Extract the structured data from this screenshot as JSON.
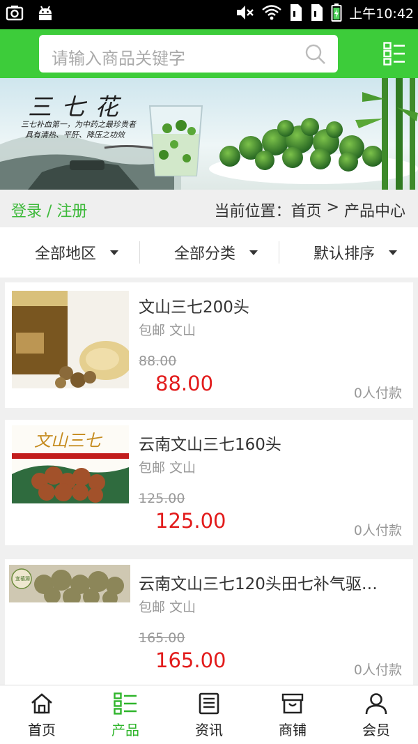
{
  "status_bar": {
    "time": "上午10:42"
  },
  "search": {
    "placeholder": "请输入商品关键字"
  },
  "banner": {
    "title": "三七花",
    "subtitle_line1": "三七补血第一，为中药之最珍贵者",
    "subtitle_line2": "具有清热、平肝、降压之功效"
  },
  "crumbbar": {
    "login": "登录 / 注册",
    "location_label": "当前位置：",
    "home": "首页",
    "separator": " > ",
    "current": "产品中心"
  },
  "filters": [
    {
      "label": "全部地区"
    },
    {
      "label": "全部分类"
    },
    {
      "label": "默认排序"
    }
  ],
  "products": [
    {
      "title": "文山三七200头",
      "tags": "包邮 文山",
      "old_price": "88.00",
      "price": "88.00",
      "sold": "0人付款"
    },
    {
      "title": "云南文山三七160头",
      "tags": "包邮 文山",
      "old_price": "125.00",
      "price": "125.00",
      "sold": "0人付款"
    },
    {
      "title": "云南文山三七120头田七补气驱…",
      "tags": "包邮 文山",
      "old_price": "165.00",
      "price": "165.00",
      "sold": "0人付款"
    }
  ],
  "thumb_texts": {
    "p2": "文山三七",
    "p3": "宜禧源"
  },
  "bottom_nav": [
    {
      "label": "首页",
      "icon": "home-icon"
    },
    {
      "label": "产品",
      "icon": "grid-list-icon",
      "active": true
    },
    {
      "label": "资讯",
      "icon": "news-icon"
    },
    {
      "label": "商铺",
      "icon": "shop-icon"
    },
    {
      "label": "会员",
      "icon": "user-icon"
    }
  ],
  "colors": {
    "brand_green": "#3dcc3a",
    "price_red": "#e21b1b",
    "active_nav": "#2fb52b"
  }
}
